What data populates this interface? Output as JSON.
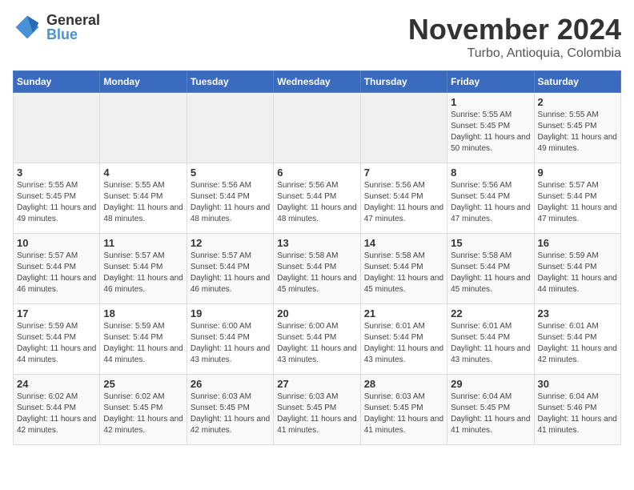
{
  "logo": {
    "line1": "General",
    "line2": "Blue"
  },
  "title": "November 2024",
  "subtitle": "Turbo, Antioquia, Colombia",
  "days_of_week": [
    "Sunday",
    "Monday",
    "Tuesday",
    "Wednesday",
    "Thursday",
    "Friday",
    "Saturday"
  ],
  "weeks": [
    [
      {
        "day": "",
        "info": ""
      },
      {
        "day": "",
        "info": ""
      },
      {
        "day": "",
        "info": ""
      },
      {
        "day": "",
        "info": ""
      },
      {
        "day": "",
        "info": ""
      },
      {
        "day": "1",
        "info": "Sunrise: 5:55 AM\nSunset: 5:45 PM\nDaylight: 11 hours\nand 50 minutes."
      },
      {
        "day": "2",
        "info": "Sunrise: 5:55 AM\nSunset: 5:45 PM\nDaylight: 11 hours\nand 49 minutes."
      }
    ],
    [
      {
        "day": "3",
        "info": "Sunrise: 5:55 AM\nSunset: 5:45 PM\nDaylight: 11 hours\nand 49 minutes."
      },
      {
        "day": "4",
        "info": "Sunrise: 5:55 AM\nSunset: 5:44 PM\nDaylight: 11 hours\nand 48 minutes."
      },
      {
        "day": "5",
        "info": "Sunrise: 5:56 AM\nSunset: 5:44 PM\nDaylight: 11 hours\nand 48 minutes."
      },
      {
        "day": "6",
        "info": "Sunrise: 5:56 AM\nSunset: 5:44 PM\nDaylight: 11 hours\nand 48 minutes."
      },
      {
        "day": "7",
        "info": "Sunrise: 5:56 AM\nSunset: 5:44 PM\nDaylight: 11 hours\nand 47 minutes."
      },
      {
        "day": "8",
        "info": "Sunrise: 5:56 AM\nSunset: 5:44 PM\nDaylight: 11 hours\nand 47 minutes."
      },
      {
        "day": "9",
        "info": "Sunrise: 5:57 AM\nSunset: 5:44 PM\nDaylight: 11 hours\nand 47 minutes."
      }
    ],
    [
      {
        "day": "10",
        "info": "Sunrise: 5:57 AM\nSunset: 5:44 PM\nDaylight: 11 hours\nand 46 minutes."
      },
      {
        "day": "11",
        "info": "Sunrise: 5:57 AM\nSunset: 5:44 PM\nDaylight: 11 hours\nand 46 minutes."
      },
      {
        "day": "12",
        "info": "Sunrise: 5:57 AM\nSunset: 5:44 PM\nDaylight: 11 hours\nand 46 minutes."
      },
      {
        "day": "13",
        "info": "Sunrise: 5:58 AM\nSunset: 5:44 PM\nDaylight: 11 hours\nand 45 minutes."
      },
      {
        "day": "14",
        "info": "Sunrise: 5:58 AM\nSunset: 5:44 PM\nDaylight: 11 hours\nand 45 minutes."
      },
      {
        "day": "15",
        "info": "Sunrise: 5:58 AM\nSunset: 5:44 PM\nDaylight: 11 hours\nand 45 minutes."
      },
      {
        "day": "16",
        "info": "Sunrise: 5:59 AM\nSunset: 5:44 PM\nDaylight: 11 hours\nand 44 minutes."
      }
    ],
    [
      {
        "day": "17",
        "info": "Sunrise: 5:59 AM\nSunset: 5:44 PM\nDaylight: 11 hours\nand 44 minutes."
      },
      {
        "day": "18",
        "info": "Sunrise: 5:59 AM\nSunset: 5:44 PM\nDaylight: 11 hours\nand 44 minutes."
      },
      {
        "day": "19",
        "info": "Sunrise: 6:00 AM\nSunset: 5:44 PM\nDaylight: 11 hours\nand 43 minutes."
      },
      {
        "day": "20",
        "info": "Sunrise: 6:00 AM\nSunset: 5:44 PM\nDaylight: 11 hours\nand 43 minutes."
      },
      {
        "day": "21",
        "info": "Sunrise: 6:01 AM\nSunset: 5:44 PM\nDaylight: 11 hours\nand 43 minutes."
      },
      {
        "day": "22",
        "info": "Sunrise: 6:01 AM\nSunset: 5:44 PM\nDaylight: 11 hours\nand 43 minutes."
      },
      {
        "day": "23",
        "info": "Sunrise: 6:01 AM\nSunset: 5:44 PM\nDaylight: 11 hours\nand 42 minutes."
      }
    ],
    [
      {
        "day": "24",
        "info": "Sunrise: 6:02 AM\nSunset: 5:44 PM\nDaylight: 11 hours\nand 42 minutes."
      },
      {
        "day": "25",
        "info": "Sunrise: 6:02 AM\nSunset: 5:45 PM\nDaylight: 11 hours\nand 42 minutes."
      },
      {
        "day": "26",
        "info": "Sunrise: 6:03 AM\nSunset: 5:45 PM\nDaylight: 11 hours\nand 42 minutes."
      },
      {
        "day": "27",
        "info": "Sunrise: 6:03 AM\nSunset: 5:45 PM\nDaylight: 11 hours\nand 41 minutes."
      },
      {
        "day": "28",
        "info": "Sunrise: 6:03 AM\nSunset: 5:45 PM\nDaylight: 11 hours\nand 41 minutes."
      },
      {
        "day": "29",
        "info": "Sunrise: 6:04 AM\nSunset: 5:45 PM\nDaylight: 11 hours\nand 41 minutes."
      },
      {
        "day": "30",
        "info": "Sunrise: 6:04 AM\nSunset: 5:46 PM\nDaylight: 11 hours\nand 41 minutes."
      }
    ]
  ]
}
